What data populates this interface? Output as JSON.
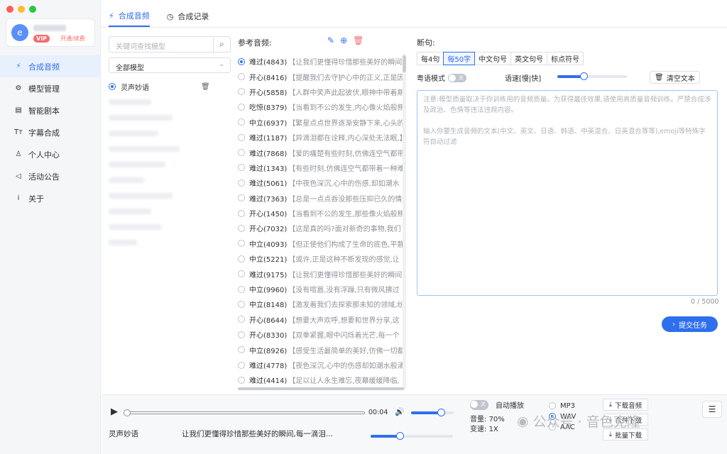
{
  "window": {
    "buttons": [
      "close",
      "minimize",
      "maximize"
    ],
    "colors": [
      "#ff5f57",
      "#febc2e",
      "#28c840"
    ]
  },
  "user": {
    "avatar_letter": "e",
    "vip_badge": "VIP",
    "renew_label": "开通/续费"
  },
  "sidebar": {
    "items": [
      {
        "label": "合成音频",
        "icon": "⚡",
        "active": true
      },
      {
        "label": "模型管理",
        "icon": "⚙",
        "active": false
      },
      {
        "label": "智能剧本",
        "icon": "▤",
        "active": false
      },
      {
        "label": "字幕合成",
        "icon": "Tт",
        "active": false
      },
      {
        "label": "个人中心",
        "icon": "♙",
        "active": false
      },
      {
        "label": "活动公告",
        "icon": "◁",
        "active": false
      },
      {
        "label": "关于",
        "icon": "i",
        "active": false
      }
    ]
  },
  "tabs": [
    {
      "label": "合成音频",
      "active": true
    },
    {
      "label": "合成记录",
      "active": false
    }
  ],
  "models": {
    "search_placeholder": "关键词查找模型",
    "filter_selected": "全部模型",
    "selected_model": "灵声妙语"
  },
  "reference": {
    "title": "参考音频:",
    "items": [
      {
        "label": "难过(4843)",
        "text": "【让我们更懂得珍惜那些美好的瞬间,",
        "selected": true
      },
      {
        "label": "开心(8416)",
        "text": "【提醒我们去守护心中的正义,正是因",
        "selected": false
      },
      {
        "label": "开心(5858)",
        "text": "【人群中笑声此起彼伏,眼神中带着期",
        "selected": false
      },
      {
        "label": "吃惊(8379)",
        "text": "【当看到不公的发生,内心像火焰般熊",
        "selected": false
      },
      {
        "label": "中立(6937)",
        "text": "【繁星点点世界逐渐安静下来,心头的",
        "selected": false
      },
      {
        "label": "难过(1187)",
        "text": "【异滴泪都在诠释,内心深处无法眠,】",
        "selected": false
      },
      {
        "label": "难过(7868)",
        "text": "【爱的痛楚有些时刻,仿佛连空气都带",
        "selected": false
      },
      {
        "label": "难过(1343)",
        "text": "【有些时刻,仿佛连空气都带着一种难",
        "selected": false
      },
      {
        "label": "难过(5061)",
        "text": "【中夜色深沉,心中的伤感,却如潮水",
        "selected": false
      },
      {
        "label": "难过(7363)",
        "text": "【总是一点点吞没那些压抑已久的情绪",
        "selected": false
      },
      {
        "label": "开心(1450)",
        "text": "【当看到不公的发生,那些像火焰般熊",
        "selected": false
      },
      {
        "label": "开心(7032)",
        "text": "【这是真的吗?面对新奇的事物,我们",
        "selected": false
      },
      {
        "label": "中立(4093)",
        "text": "【但正使他们构成了生命的底色,平静",
        "selected": false
      },
      {
        "label": "中立(5221)",
        "text": "【或许,正是这种不断发现的感觉,让",
        "selected": false
      },
      {
        "label": "难过(9175)",
        "text": "【让我们更懂得珍惜那些美好的瞬间,】",
        "selected": false
      },
      {
        "label": "中立(9960)",
        "text": "【没有喧嚣,没有浮躁,只有微风拂过",
        "selected": false
      },
      {
        "label": "中立(8148)",
        "text": "【激发着我们去探索那未知的领域,纷",
        "selected": false
      },
      {
        "label": "开心(8644)",
        "text": "【想要大声欢呼,想要和世界分享,这",
        "selected": false
      },
      {
        "label": "开心(8330)",
        "text": "【双拳紧握,眼中闪烁着光芒,每一个",
        "selected": false
      },
      {
        "label": "中立(8926)",
        "text": "【感受生活最简单的美好,仿佛一切都",
        "selected": false
      },
      {
        "label": "难过(4778)",
        "text": "【夜色深沉,心中的伤感却如潮水般涌",
        "selected": false
      },
      {
        "label": "难过(4414)",
        "text": "【足以让人永生难忘,夜幕缓缓降临,",
        "selected": false
      }
    ]
  },
  "compose": {
    "split_label": "断句:",
    "split_options": [
      {
        "label": "每4句",
        "active": false
      },
      {
        "label": "每50字",
        "active": true
      },
      {
        "label": "中文句号",
        "active": false
      },
      {
        "label": "英文句号",
        "active": false
      },
      {
        "label": "标点符号",
        "active": false
      }
    ],
    "cantonese_label": "粤语模式",
    "cantonese_toggle": "关",
    "speed_label": "语速[慢|快]",
    "speed_value": 0.38,
    "clear_label": "清空文本",
    "placeholder_line1": "注意:模型质量取决于你训练用的音频质量。为获得最佳效果,请使用高质量音频训练。严禁合成涉及政治、色情等违法违规内容。",
    "placeholder_line2": "输入你要生成音频的文本(中文、英文、日语、韩语、中英混合、日英混合等等),emoji等特殊字符自动过滤",
    "counter": "0 / 5000",
    "submit_label": "提交任务"
  },
  "player": {
    "time": "00:04",
    "progress": 0.0,
    "volume": 0.7,
    "speed_slider": 0.35,
    "now_playing_name": "灵声妙语",
    "now_playing_text": "让我们更懂得珍惜那些美好的瞬间,每一滴泪...",
    "autoplay_label": "自动播放",
    "autoplay_toggle": "关",
    "volume_label": "音量:",
    "volume_value": "70%",
    "speed_label": "变速:",
    "speed_value": "1X",
    "formats": [
      {
        "label": "MP3",
        "selected": false
      },
      {
        "label": "WAV",
        "selected": true
      },
      {
        "label": "AAC",
        "selected": false
      }
    ],
    "download_label": "下载音频",
    "merge_label": "合并下载",
    "batch_label": "批量下载"
  },
  "watermark": "公众号 · 音色克隆",
  "colors": {
    "accent": "#2f6fed",
    "vip": "#f56c6c",
    "sidebar_bg": "#f5f6f8"
  }
}
